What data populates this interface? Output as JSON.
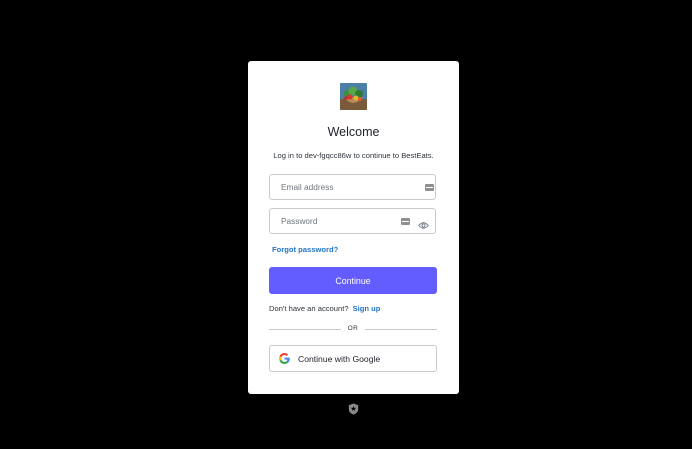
{
  "login": {
    "title": "Welcome",
    "subtitle": "Log in to dev-fgqcc86w to continue to BestEats.",
    "email_placeholder": "Email address",
    "password_placeholder": "Password",
    "forgot_password": "Forgot password?",
    "continue_label": "Continue",
    "no_account_text": "Don't have an account?",
    "signup_link": "Sign up",
    "divider_text": "OR",
    "google_label": "Continue with Google"
  },
  "icons": {
    "logo": "food-bowl-logo",
    "password_manager": "password-manager-icon",
    "show_password": "eye-icon",
    "google": "google-icon",
    "footer": "shield-icon"
  },
  "colors": {
    "background": "#000000",
    "primary_button": "#635dff",
    "link": "#1f74c6"
  }
}
